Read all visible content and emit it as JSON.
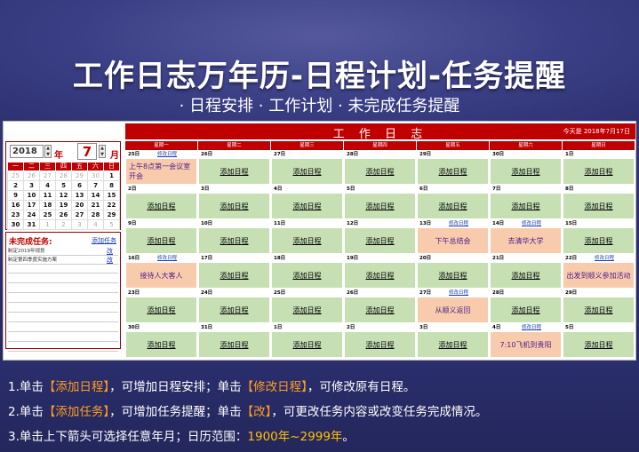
{
  "title": "工作日志万年历-日程计划-任务提醒",
  "subtitle": "· 日程安排 · 工作计划 · 未完成任务提醒",
  "sheet": {
    "header": "工 作 日 志",
    "today": "今天是 2018年7月17日"
  },
  "mini": {
    "year": "2018",
    "year_label": "年",
    "month": "7",
    "month_label": "月",
    "up": "▲",
    "down": "▼",
    "weekdays": [
      "一",
      "二",
      "三",
      "四",
      "五",
      "六",
      "日"
    ],
    "rows": [
      [
        "25",
        "26",
        "27",
        "28",
        "29",
        "30",
        "1"
      ],
      [
        "2",
        "3",
        "4",
        "5",
        "6",
        "7",
        "8"
      ],
      [
        "9",
        "10",
        "11",
        "12",
        "13",
        "14",
        "15"
      ],
      [
        "16",
        "17",
        "18",
        "19",
        "20",
        "21",
        "22"
      ],
      [
        "23",
        "24",
        "25",
        "26",
        "27",
        "28",
        "29"
      ],
      [
        "30",
        "31",
        "1",
        "2",
        "3",
        "4",
        "5"
      ]
    ]
  },
  "tasks": {
    "label": "未完成任务:",
    "add": "添加任务",
    "items": [
      {
        "text": "制定2019年规划",
        "edit": "改"
      },
      {
        "text": "制定第四季度实施方案",
        "edit": "改"
      }
    ]
  },
  "calendar": {
    "weekdays": [
      "星期一",
      "星期二",
      "星期三",
      "星期四",
      "星期五",
      "星期六",
      "星期日"
    ],
    "modify": "修改日程",
    "add": "添加日程",
    "weeks": [
      [
        {
          "date": "25日",
          "ev": "上午8点第一会议室开会",
          "kind": "multi",
          "mod": true
        },
        {
          "date": "26日",
          "ev": "添加日程",
          "kind": "add"
        },
        {
          "date": "27日",
          "ev": "添加日程",
          "kind": "add"
        },
        {
          "date": "28日",
          "ev": "添加日程",
          "kind": "add"
        },
        {
          "date": "29日",
          "ev": "添加日程",
          "kind": "add"
        },
        {
          "date": "30日",
          "ev": "添加日程",
          "kind": "add"
        },
        {
          "date": "1日",
          "ev": "添加日程",
          "kind": "add"
        }
      ],
      [
        {
          "date": "2日",
          "ev": "添加日程",
          "kind": "add"
        },
        {
          "date": "3日",
          "ev": "添加日程",
          "kind": "add"
        },
        {
          "date": "4日",
          "ev": "添加日程",
          "kind": "add"
        },
        {
          "date": "5日",
          "ev": "添加日程",
          "kind": "add"
        },
        {
          "date": "6日",
          "ev": "添加日程",
          "kind": "add"
        },
        {
          "date": "7日",
          "ev": "添加日程",
          "kind": "add"
        },
        {
          "date": "8日",
          "ev": "添加日程",
          "kind": "add"
        }
      ],
      [
        {
          "date": "9日",
          "ev": "添加日程",
          "kind": "add"
        },
        {
          "date": "10日",
          "ev": "添加日程",
          "kind": "add"
        },
        {
          "date": "11日",
          "ev": "添加日程",
          "kind": "add"
        },
        {
          "date": "12日",
          "ev": "添加日程",
          "kind": "add"
        },
        {
          "date": "13日",
          "ev": "下午总结会",
          "kind": "sched",
          "mod": true
        },
        {
          "date": "14日",
          "ev": "去清华大学",
          "kind": "sched",
          "mod": true
        },
        {
          "date": "15日",
          "ev": "添加日程",
          "kind": "add"
        }
      ],
      [
        {
          "date": "16日",
          "ev": "接待人大客人",
          "kind": "sched",
          "mod": true
        },
        {
          "date": "17日",
          "ev": "添加日程",
          "kind": "add"
        },
        {
          "date": "18日",
          "ev": "添加日程",
          "kind": "add"
        },
        {
          "date": "19日",
          "ev": "添加日程",
          "kind": "add"
        },
        {
          "date": "20日",
          "ev": "添加日程",
          "kind": "add"
        },
        {
          "date": "21日",
          "ev": "添加日程",
          "kind": "add"
        },
        {
          "date": "22日",
          "ev": "出发到顺义参加活动",
          "kind": "sched",
          "mod": true
        }
      ],
      [
        {
          "date": "23日",
          "ev": "添加日程",
          "kind": "add"
        },
        {
          "date": "24日",
          "ev": "添加日程",
          "kind": "add"
        },
        {
          "date": "25日",
          "ev": "添加日程",
          "kind": "add"
        },
        {
          "date": "26日",
          "ev": "添加日程",
          "kind": "add"
        },
        {
          "date": "27日",
          "ev": "从顺义返回",
          "kind": "sched",
          "mod": true
        },
        {
          "date": "28日",
          "ev": "添加日程",
          "kind": "add"
        },
        {
          "date": "29日",
          "ev": "添加日程",
          "kind": "add"
        }
      ],
      [
        {
          "date": "30日",
          "ev": "添加日程",
          "kind": "add"
        },
        {
          "date": "31日",
          "ev": "添加日程",
          "kind": "add"
        },
        {
          "date": "1日",
          "ev": "添加日程",
          "kind": "add"
        },
        {
          "date": "2日",
          "ev": "添加日程",
          "kind": "add"
        },
        {
          "date": "3日",
          "ev": "添加日程",
          "kind": "add"
        },
        {
          "date": "4日",
          "ev": "7:10飞机到贵阳",
          "kind": "sched",
          "mod": true
        },
        {
          "date": "5日",
          "ev": "添加日程",
          "kind": "add"
        }
      ]
    ]
  },
  "tips": {
    "t1": {
      "a": "1.单击",
      "b": "【添加日程】",
      "c": "，可增加日程安排；单击",
      "d": "【修改日程】",
      "e": "，可修改原有日程。"
    },
    "t2": {
      "a": "2.单击",
      "b": "【添加任务】",
      "c": "，可增加任务提醒；单击",
      "d": "【改】",
      "e": "，可更改任务内容或改变任务完成情况。"
    },
    "t3": {
      "a": "3.单击上下箭头可选择任意年月；",
      "b": "日历范围：",
      "c": "1900年~2999年",
      "d": "。"
    }
  },
  "colors": {
    "accent": "#c00000",
    "add_cell": "#c6e0b4",
    "sched_cell": "#f8cbad",
    "bracket": "#ff9d1e",
    "highlight": "#ffc000"
  }
}
